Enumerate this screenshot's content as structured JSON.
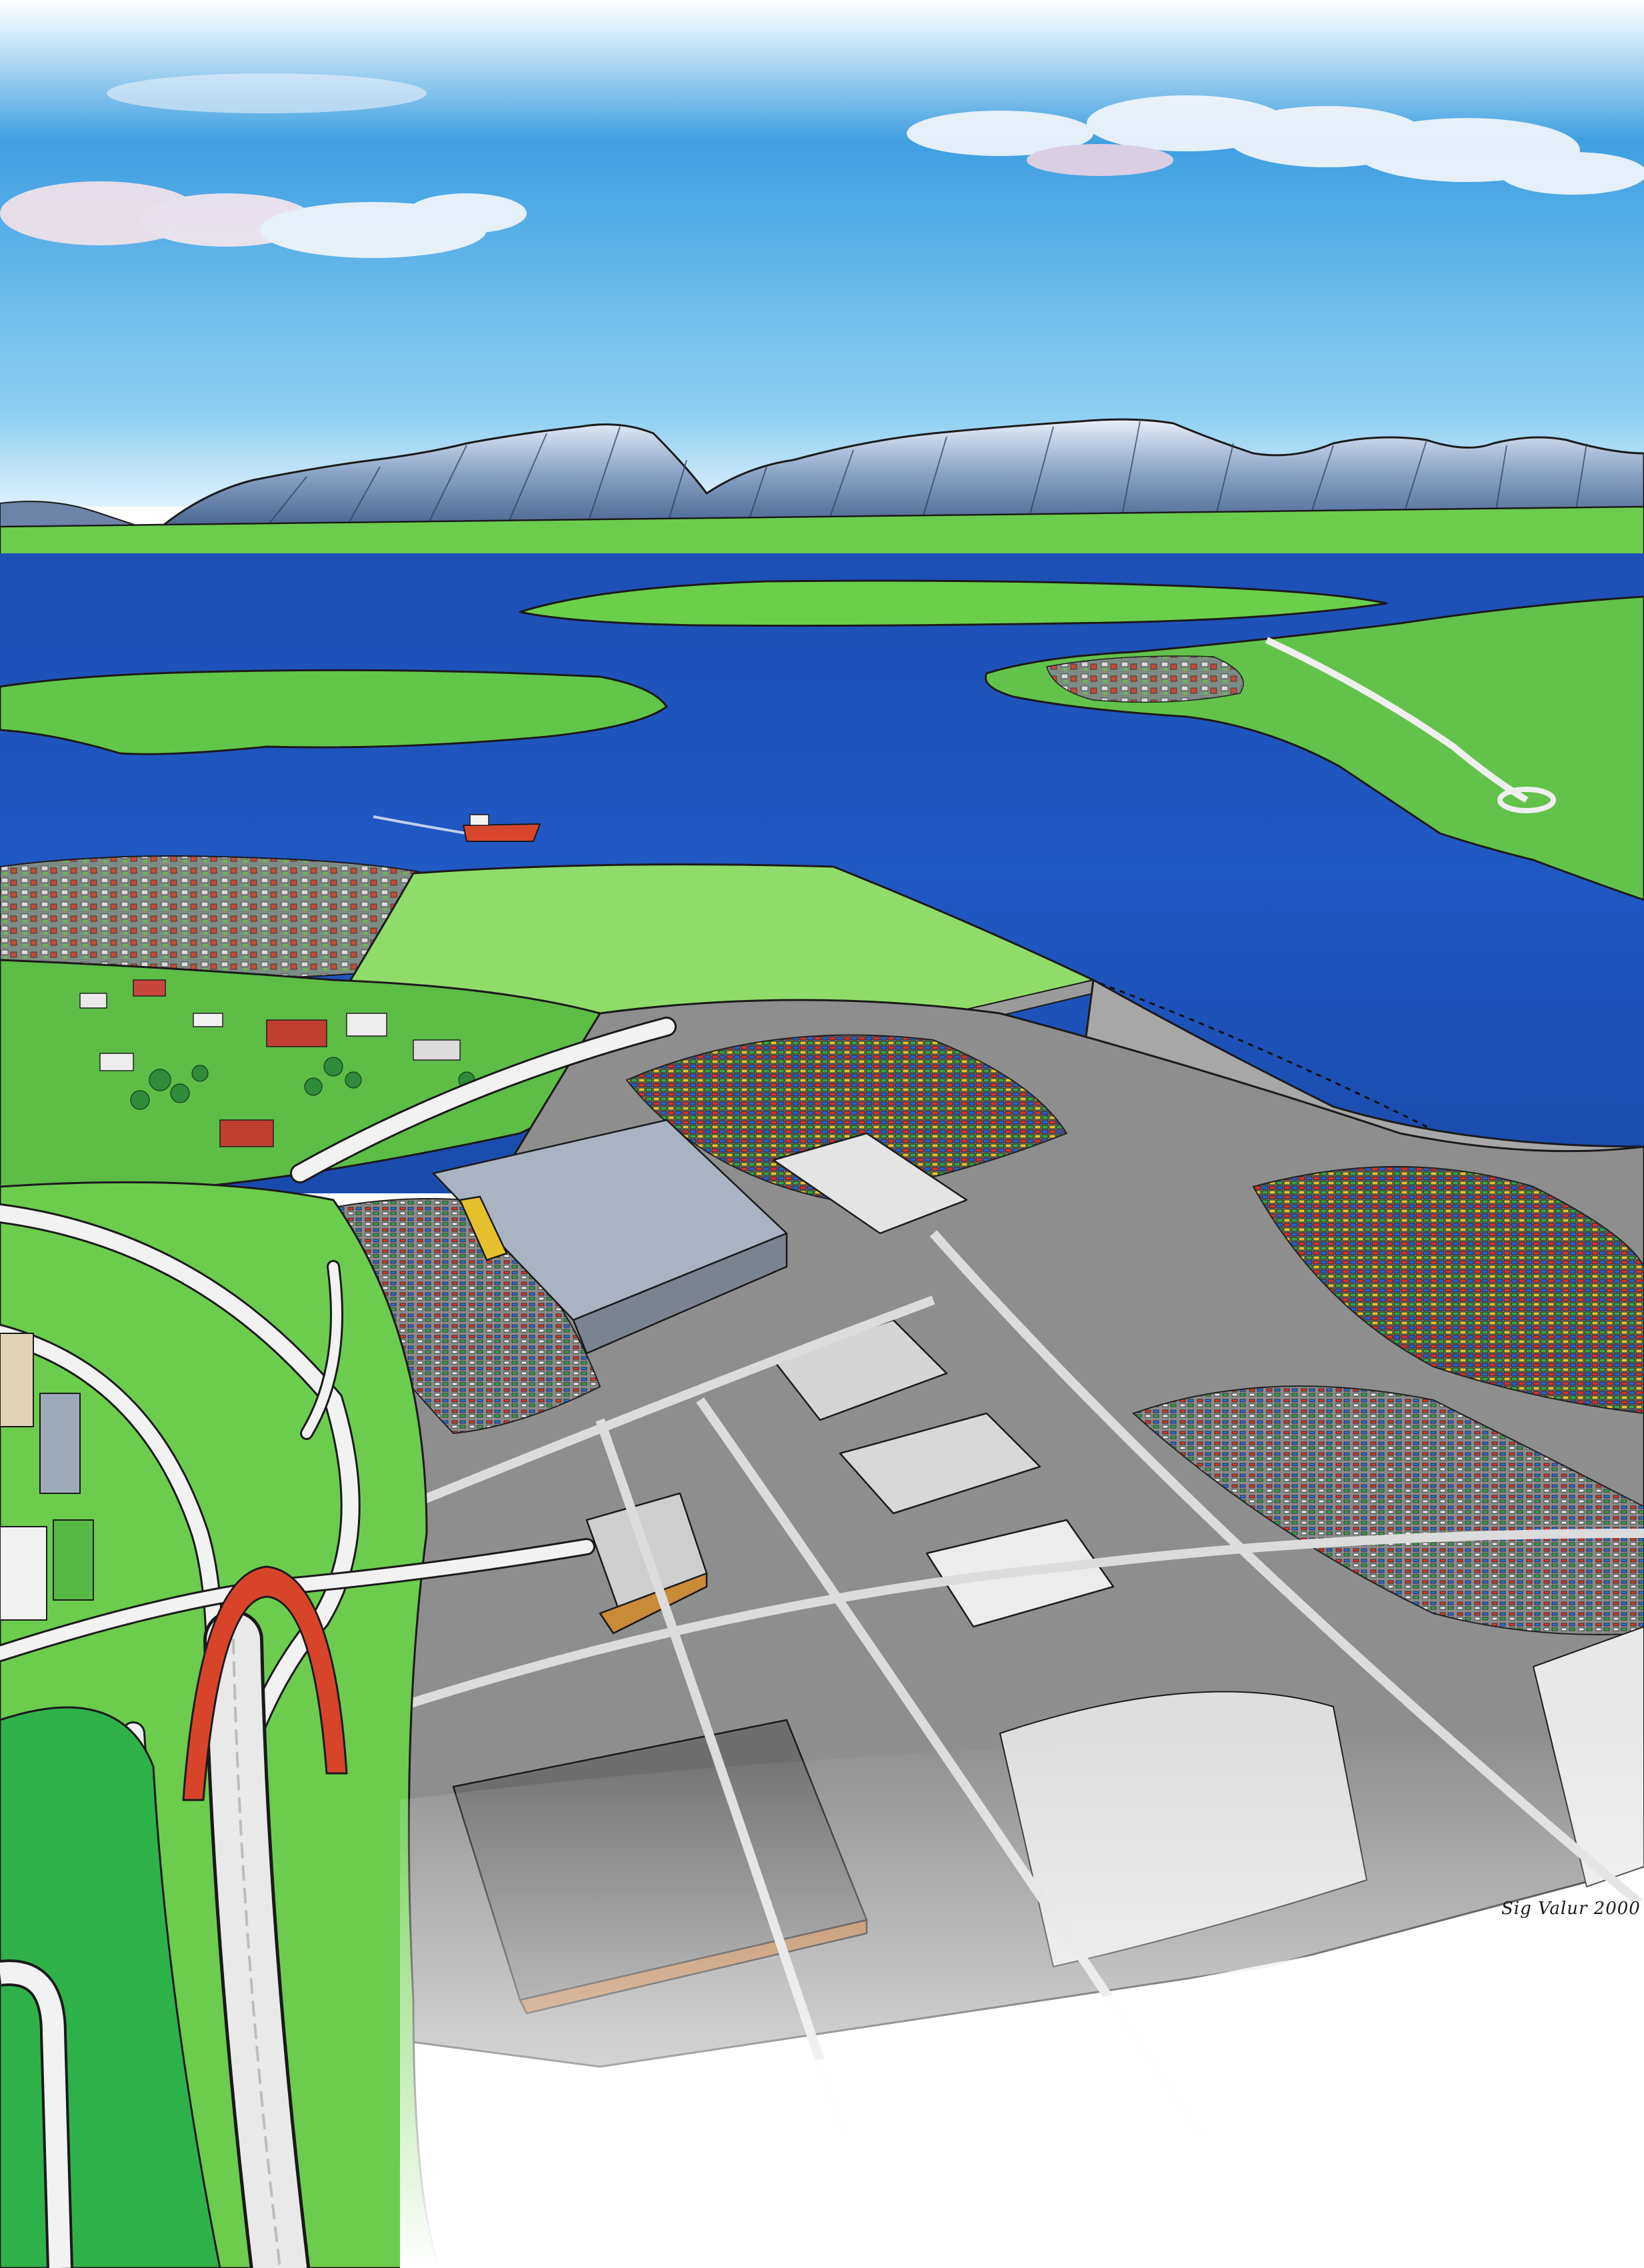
{
  "artwork": {
    "type": "illustrated aerial view",
    "palette": {
      "sky_top": "#3f9fe0",
      "sky_bottom": "#dff1fb",
      "mountain": "#4f6c96",
      "snow": "#e9eef6",
      "water": "#1c4fb8",
      "water_deep": "#133f9e",
      "grass": "#5ec24a",
      "grass_light": "#8fdc6a",
      "pavement": "#8f8f8f",
      "pavement_dark": "#6e6e6e",
      "roof": "#a9b3c2",
      "tunnel": "#d8442a",
      "paper": "#ffffff"
    }
  },
  "signature": {
    "text": "Sig Valur 2000"
  }
}
